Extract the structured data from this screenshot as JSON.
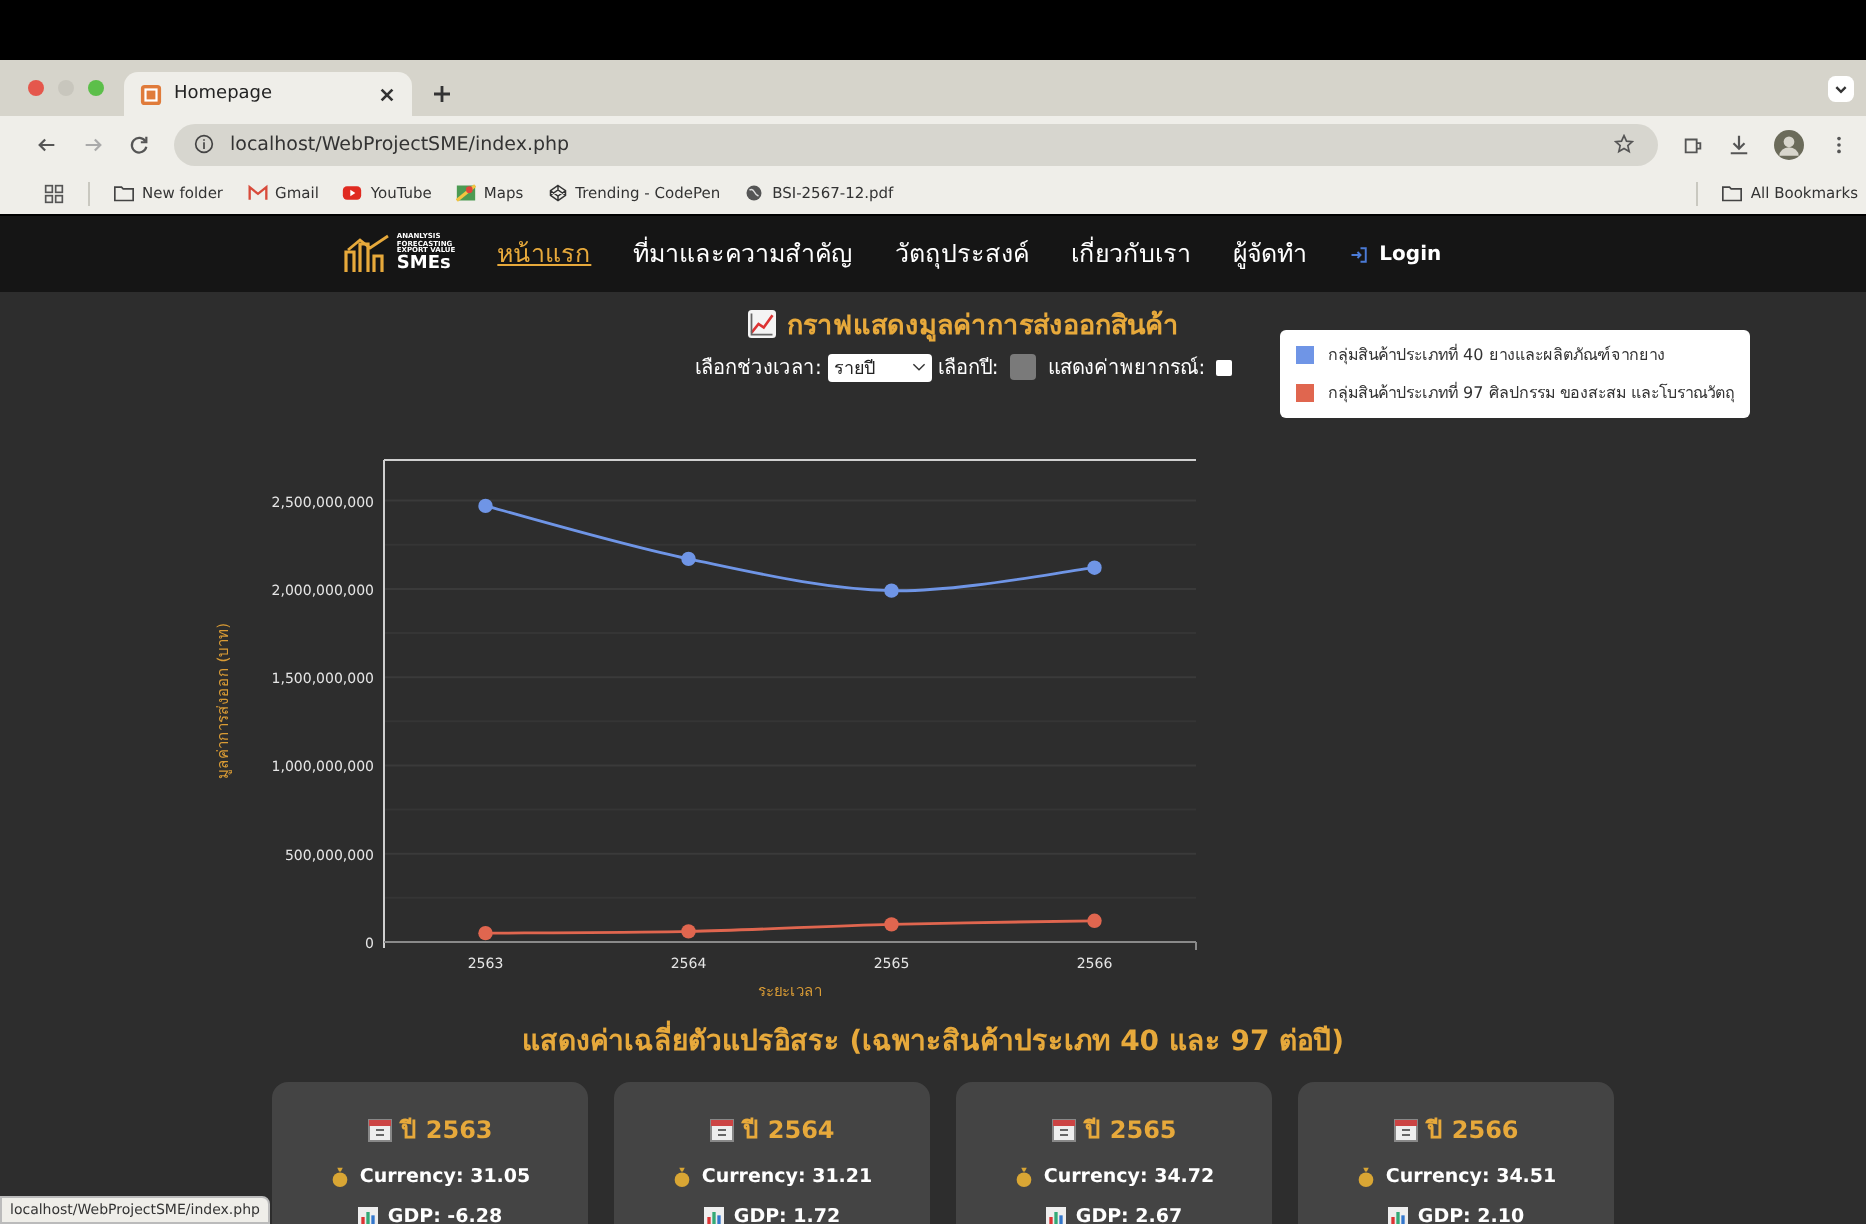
{
  "browser": {
    "tab_title": "Homepage",
    "url": "localhost/WebProjectSME/index.php",
    "bookmarks": [
      {
        "label": "New folder",
        "kind": "folder"
      },
      {
        "label": "Gmail",
        "kind": "mail"
      },
      {
        "label": "YouTube",
        "kind": "video"
      },
      {
        "label": "Maps",
        "kind": "map"
      },
      {
        "label": "Trending - CodePen",
        "kind": "codepen"
      },
      {
        "label": "BSI-2567-12.pdf",
        "kind": "globe"
      }
    ],
    "all_bookmarks": "All Bookmarks",
    "status_url": "localhost/WebProjectSME/index.php"
  },
  "nav": {
    "logo_lines": [
      "ANANLYSIS",
      "FORECASTING",
      "EXPORT VALUE",
      "SMEs"
    ],
    "items": [
      {
        "label": "หน้าแรก",
        "selected": true
      },
      {
        "label": "ที่มาและความสำคัญ",
        "selected": false
      },
      {
        "label": "วัตถุประสงค์",
        "selected": false
      },
      {
        "label": "เกี่ยวกับเรา",
        "selected": false
      },
      {
        "label": "ผู้จัดทำ",
        "selected": false
      }
    ],
    "login": "Login"
  },
  "chart_section": {
    "title": "กราฟแสดงมูลค่าการส่งออกสินค้า",
    "period_label": "เลือกช่วงเวลา:",
    "period_value": "รายปี",
    "year_label": "เลือกปี:",
    "forecast_label": "แสดงค่าพยากรณ์:",
    "forecast_checked": false,
    "chart_data": {
      "type": "line",
      "xlabel": "ระยะเวลา",
      "ylabel": "มูลค่าการส่งออก (บาท)",
      "categories": [
        "2563",
        "2564",
        "2565",
        "2566"
      ],
      "series": [
        {
          "name": "กลุ่มสินค้าประเภทที่ 40 ยางและผลิตภัณฑ์จากยาง",
          "color": "#6f95e6",
          "values": [
            2470000000,
            2170000000,
            1990000000,
            2120000000
          ],
          "marker": "circle"
        },
        {
          "name": "กลุ่มสินค้าประเภทที่ 97 ศิลปกรรม ของสะสม และโบราณวัตถุ",
          "color": "#e0664f",
          "values": [
            50000000,
            60000000,
            100000000,
            120000000
          ],
          "marker": "circle"
        }
      ],
      "grid": true,
      "ylim": [
        0,
        2730000000
      ],
      "yticks": [
        {
          "value": 0,
          "label": "0"
        },
        {
          "value": 500000000,
          "label": "500,000,000"
        },
        {
          "value": 1000000000,
          "label": "1,000,000,000"
        },
        {
          "value": 1500000000,
          "label": "1,500,000,000"
        },
        {
          "value": 2000000000,
          "label": "2,000,000,000"
        },
        {
          "value": 2500000000,
          "label": "2,500,000,000"
        }
      ]
    }
  },
  "summary": {
    "title": "แสดงค่าเฉลี่ยตัวแปรอิสระ (เฉพาะสินค้าประเภท 40 และ 97 ต่อปี)",
    "cards": [
      {
        "year": "ปี 2563",
        "currency": "Currency: 31.05",
        "gdp": "GDP: -6.28"
      },
      {
        "year": "ปี 2564",
        "currency": "Currency: 31.21",
        "gdp": "GDP: 1.72"
      },
      {
        "year": "ปี 2565",
        "currency": "Currency: 34.72",
        "gdp": "GDP: 2.67"
      },
      {
        "year": "ปี 2566",
        "currency": "Currency: 34.51",
        "gdp": "GDP: 2.10"
      }
    ]
  }
}
